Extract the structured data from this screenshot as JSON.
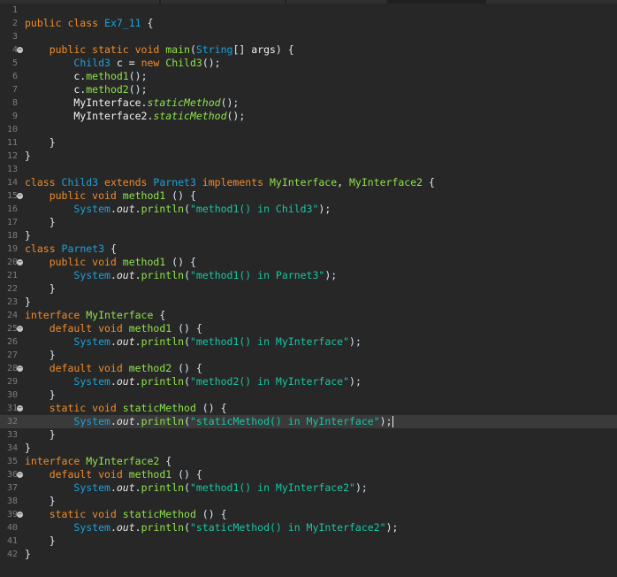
{
  "editor": {
    "active_line": 32,
    "colors": {
      "background": "#272727",
      "keyword": "#f08b2b",
      "type": "#1ea1d8",
      "method": "#8fe34c",
      "string": "#17c6a3"
    },
    "lines": [
      {
        "n": "1",
        "fold": false,
        "tokens": []
      },
      {
        "n": "2",
        "fold": false,
        "tokens": [
          {
            "t": "public class ",
            "c": "kw"
          },
          {
            "t": "Ex7_11",
            "c": "ty"
          },
          {
            "t": " {",
            "c": "pn"
          }
        ]
      },
      {
        "n": "3",
        "fold": false,
        "tokens": []
      },
      {
        "n": "4",
        "fold": true,
        "tokens": [
          {
            "t": "    public static void ",
            "c": "kw"
          },
          {
            "t": "main",
            "c": "fn"
          },
          {
            "t": "(",
            "c": "pn"
          },
          {
            "t": "String",
            "c": "ty"
          },
          {
            "t": "[] ",
            "c": "pn"
          },
          {
            "t": "args",
            "c": "id"
          },
          {
            "t": ") {",
            "c": "pn"
          }
        ]
      },
      {
        "n": "5",
        "fold": false,
        "tokens": [
          {
            "t": "        ",
            "c": "pn"
          },
          {
            "t": "Child3",
            "c": "ty"
          },
          {
            "t": " c = ",
            "c": "id"
          },
          {
            "t": "new ",
            "c": "kw"
          },
          {
            "t": "Child3",
            "c": "fn"
          },
          {
            "t": "();",
            "c": "pn"
          }
        ]
      },
      {
        "n": "6",
        "fold": false,
        "tokens": [
          {
            "t": "        c.",
            "c": "id"
          },
          {
            "t": "method1",
            "c": "fn"
          },
          {
            "t": "();",
            "c": "pn"
          }
        ]
      },
      {
        "n": "7",
        "fold": false,
        "tokens": [
          {
            "t": "        c.",
            "c": "id"
          },
          {
            "t": "method2",
            "c": "fn"
          },
          {
            "t": "();",
            "c": "pn"
          }
        ]
      },
      {
        "n": "8",
        "fold": false,
        "tokens": [
          {
            "t": "        MyInterface.",
            "c": "id"
          },
          {
            "t": "staticMethod",
            "c": "sm"
          },
          {
            "t": "();",
            "c": "pn"
          }
        ]
      },
      {
        "n": "9",
        "fold": false,
        "tokens": [
          {
            "t": "        MyInterface2.",
            "c": "id"
          },
          {
            "t": "staticMethod",
            "c": "sm"
          },
          {
            "t": "();",
            "c": "pn"
          }
        ]
      },
      {
        "n": "10",
        "fold": false,
        "tokens": []
      },
      {
        "n": "11",
        "fold": false,
        "tokens": [
          {
            "t": "    }",
            "c": "pn"
          }
        ]
      },
      {
        "n": "12",
        "fold": false,
        "tokens": [
          {
            "t": "}",
            "c": "pn"
          }
        ]
      },
      {
        "n": "13",
        "fold": false,
        "tokens": []
      },
      {
        "n": "14",
        "fold": false,
        "tokens": [
          {
            "t": "class ",
            "c": "kw"
          },
          {
            "t": "Child3",
            "c": "ty"
          },
          {
            "t": " extends ",
            "c": "kw"
          },
          {
            "t": "Parnet3",
            "c": "ty"
          },
          {
            "t": " implements ",
            "c": "kw"
          },
          {
            "t": "MyInterface",
            "c": "fn"
          },
          {
            "t": ", ",
            "c": "pn"
          },
          {
            "t": "MyInterface2",
            "c": "fn"
          },
          {
            "t": " {",
            "c": "pn"
          }
        ]
      },
      {
        "n": "15",
        "fold": true,
        "tokens": [
          {
            "t": "    public void ",
            "c": "kw"
          },
          {
            "t": "method1",
            "c": "fn"
          },
          {
            "t": " () {",
            "c": "pn"
          }
        ]
      },
      {
        "n": "16",
        "fold": false,
        "tokens": [
          {
            "t": "        ",
            "c": "pn"
          },
          {
            "t": "System",
            "c": "ty"
          },
          {
            "t": ".",
            "c": "pn"
          },
          {
            "t": "out",
            "c": "fld"
          },
          {
            "t": ".",
            "c": "pn"
          },
          {
            "t": "println",
            "c": "fn"
          },
          {
            "t": "(",
            "c": "pn"
          },
          {
            "t": "\"method1() in Child3\"",
            "c": "str"
          },
          {
            "t": ");",
            "c": "pn"
          }
        ]
      },
      {
        "n": "17",
        "fold": false,
        "tokens": [
          {
            "t": "    }",
            "c": "pn"
          }
        ]
      },
      {
        "n": "18",
        "fold": false,
        "tokens": [
          {
            "t": "}",
            "c": "pn"
          }
        ]
      },
      {
        "n": "19",
        "fold": false,
        "tokens": [
          {
            "t": "class ",
            "c": "kw"
          },
          {
            "t": "Parnet3",
            "c": "ty"
          },
          {
            "t": " {",
            "c": "pn"
          }
        ]
      },
      {
        "n": "20",
        "fold": true,
        "tokens": [
          {
            "t": "    public void ",
            "c": "kw"
          },
          {
            "t": "method1",
            "c": "fn"
          },
          {
            "t": " () {",
            "c": "pn"
          }
        ]
      },
      {
        "n": "21",
        "fold": false,
        "tokens": [
          {
            "t": "        ",
            "c": "pn"
          },
          {
            "t": "System",
            "c": "ty"
          },
          {
            "t": ".",
            "c": "pn"
          },
          {
            "t": "out",
            "c": "fld"
          },
          {
            "t": ".",
            "c": "pn"
          },
          {
            "t": "println",
            "c": "fn"
          },
          {
            "t": "(",
            "c": "pn"
          },
          {
            "t": "\"method1() in Parnet3\"",
            "c": "str"
          },
          {
            "t": ");",
            "c": "pn"
          }
        ]
      },
      {
        "n": "22",
        "fold": false,
        "tokens": [
          {
            "t": "    }",
            "c": "pn"
          }
        ]
      },
      {
        "n": "23",
        "fold": false,
        "tokens": [
          {
            "t": "}",
            "c": "pn"
          }
        ]
      },
      {
        "n": "24",
        "fold": false,
        "tokens": [
          {
            "t": "interface ",
            "c": "kw"
          },
          {
            "t": "MyInterface",
            "c": "fn"
          },
          {
            "t": " {",
            "c": "pn"
          }
        ]
      },
      {
        "n": "25",
        "fold": true,
        "tokens": [
          {
            "t": "    default void ",
            "c": "kw"
          },
          {
            "t": "method1",
            "c": "fn"
          },
          {
            "t": " () {",
            "c": "pn"
          }
        ]
      },
      {
        "n": "26",
        "fold": false,
        "tokens": [
          {
            "t": "        ",
            "c": "pn"
          },
          {
            "t": "System",
            "c": "ty"
          },
          {
            "t": ".",
            "c": "pn"
          },
          {
            "t": "out",
            "c": "fld"
          },
          {
            "t": ".",
            "c": "pn"
          },
          {
            "t": "println",
            "c": "fn"
          },
          {
            "t": "(",
            "c": "pn"
          },
          {
            "t": "\"method1() in MyInterface\"",
            "c": "str"
          },
          {
            "t": ");",
            "c": "pn"
          }
        ]
      },
      {
        "n": "27",
        "fold": false,
        "tokens": [
          {
            "t": "    }",
            "c": "pn"
          }
        ]
      },
      {
        "n": "28",
        "fold": true,
        "tokens": [
          {
            "t": "    default void ",
            "c": "kw"
          },
          {
            "t": "method2",
            "c": "fn"
          },
          {
            "t": " () {",
            "c": "pn"
          }
        ]
      },
      {
        "n": "29",
        "fold": false,
        "tokens": [
          {
            "t": "        ",
            "c": "pn"
          },
          {
            "t": "System",
            "c": "ty"
          },
          {
            "t": ".",
            "c": "pn"
          },
          {
            "t": "out",
            "c": "fld"
          },
          {
            "t": ".",
            "c": "pn"
          },
          {
            "t": "println",
            "c": "fn"
          },
          {
            "t": "(",
            "c": "pn"
          },
          {
            "t": "\"method2() in MyInterface\"",
            "c": "str"
          },
          {
            "t": ");",
            "c": "pn"
          }
        ]
      },
      {
        "n": "30",
        "fold": false,
        "tokens": [
          {
            "t": "    }",
            "c": "pn"
          }
        ]
      },
      {
        "n": "31",
        "fold": true,
        "tokens": [
          {
            "t": "    static void ",
            "c": "kw"
          },
          {
            "t": "staticMethod",
            "c": "fn"
          },
          {
            "t": " () {",
            "c": "pn"
          }
        ]
      },
      {
        "n": "32",
        "fold": false,
        "tokens": [
          {
            "t": "        ",
            "c": "pn"
          },
          {
            "t": "System",
            "c": "ty"
          },
          {
            "t": ".",
            "c": "pn"
          },
          {
            "t": "out",
            "c": "fld"
          },
          {
            "t": ".",
            "c": "pn"
          },
          {
            "t": "println",
            "c": "fn"
          },
          {
            "t": "(",
            "c": "pn"
          },
          {
            "t": "\"staticMethod() in MyInterface\"",
            "c": "str"
          },
          {
            "t": ");",
            "c": "pn"
          }
        ]
      },
      {
        "n": "33",
        "fold": false,
        "tokens": [
          {
            "t": "    }",
            "c": "pn"
          }
        ]
      },
      {
        "n": "34",
        "fold": false,
        "tokens": [
          {
            "t": "}",
            "c": "pn"
          }
        ]
      },
      {
        "n": "35",
        "fold": false,
        "tokens": [
          {
            "t": "interface ",
            "c": "kw"
          },
          {
            "t": "MyInterface2",
            "c": "fn"
          },
          {
            "t": " {",
            "c": "pn"
          }
        ]
      },
      {
        "n": "36",
        "fold": true,
        "tokens": [
          {
            "t": "    default void ",
            "c": "kw"
          },
          {
            "t": "method1",
            "c": "fn"
          },
          {
            "t": " () {",
            "c": "pn"
          }
        ]
      },
      {
        "n": "37",
        "fold": false,
        "tokens": [
          {
            "t": "        ",
            "c": "pn"
          },
          {
            "t": "System",
            "c": "ty"
          },
          {
            "t": ".",
            "c": "pn"
          },
          {
            "t": "out",
            "c": "fld"
          },
          {
            "t": ".",
            "c": "pn"
          },
          {
            "t": "println",
            "c": "fn"
          },
          {
            "t": "(",
            "c": "pn"
          },
          {
            "t": "\"method1() in MyInterface2\"",
            "c": "str"
          },
          {
            "t": ");",
            "c": "pn"
          }
        ]
      },
      {
        "n": "38",
        "fold": false,
        "tokens": [
          {
            "t": "    }",
            "c": "pn"
          }
        ]
      },
      {
        "n": "39",
        "fold": true,
        "tokens": [
          {
            "t": "    static void ",
            "c": "kw"
          },
          {
            "t": "staticMethod",
            "c": "fn"
          },
          {
            "t": " () {",
            "c": "pn"
          }
        ]
      },
      {
        "n": "40",
        "fold": false,
        "tokens": [
          {
            "t": "        ",
            "c": "pn"
          },
          {
            "t": "System",
            "c": "ty"
          },
          {
            "t": ".",
            "c": "pn"
          },
          {
            "t": "out",
            "c": "fld"
          },
          {
            "t": ".",
            "c": "pn"
          },
          {
            "t": "println",
            "c": "fn"
          },
          {
            "t": "(",
            "c": "pn"
          },
          {
            "t": "\"staticMethod() in MyInterface2\"",
            "c": "str"
          },
          {
            "t": ");",
            "c": "pn"
          }
        ]
      },
      {
        "n": "41",
        "fold": false,
        "tokens": [
          {
            "t": "    }",
            "c": "pn"
          }
        ]
      },
      {
        "n": "42",
        "fold": false,
        "tokens": [
          {
            "t": "}",
            "c": "pn"
          }
        ]
      }
    ]
  }
}
